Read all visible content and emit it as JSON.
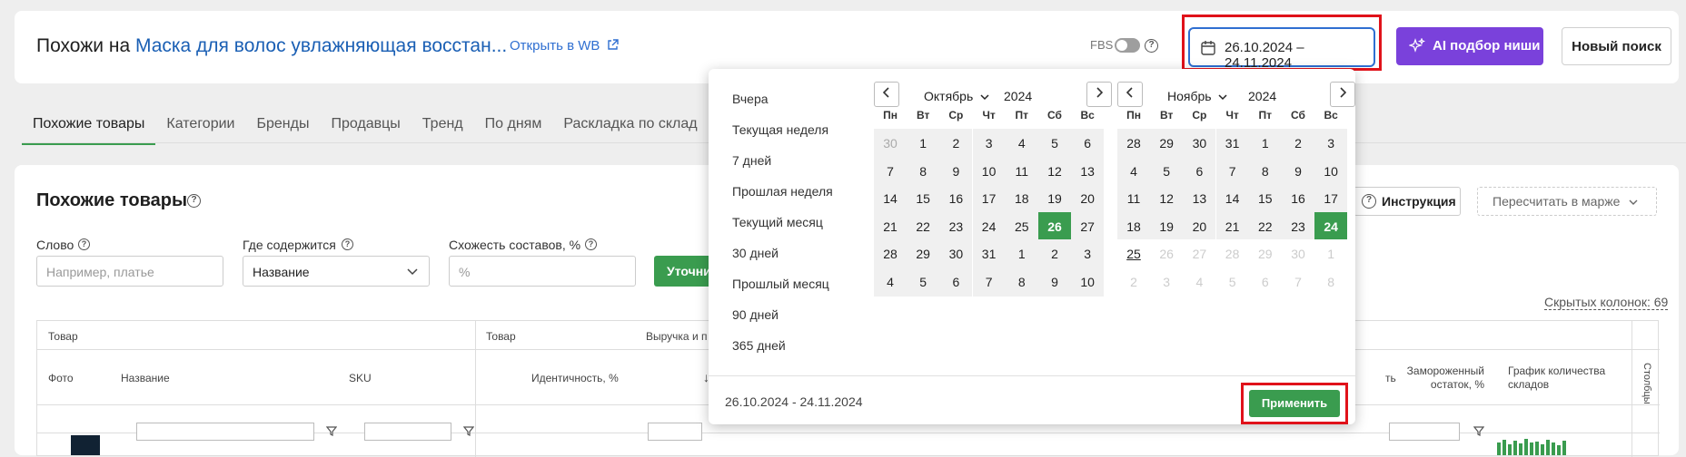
{
  "header": {
    "title_prefix": "Похожи на",
    "product_link": "Маска для волос увлажняющая восстан...",
    "open_wb": "Открыть в WB",
    "fbs_label": "FBS",
    "date_range": "26.10.2024 – 24.11.2024",
    "ai_button": "AI подбор ниши",
    "new_search": "Новый поиск"
  },
  "tabs": [
    "Похожие товары",
    "Категории",
    "Бренды",
    "Продавцы",
    "Тренд",
    "По дням",
    "Раскладка по склад"
  ],
  "main": {
    "section_title": "Похожие товары",
    "instruction": "Инструкция",
    "recalc": "Пересчитать в марже",
    "hidden_cols": "Скрытых колонок: 69",
    "filters": {
      "word_label": "Слово",
      "word_placeholder": "Например, платье",
      "where_label": "Где содержится",
      "where_value": "Название",
      "similarity_label": "Схожесть составов, %",
      "similarity_placeholder": "%",
      "refine_button": "Уточни"
    },
    "table": {
      "group1": "Товар",
      "group2": "Товар",
      "group3": "Выручка и п",
      "col_photo": "Фото",
      "col_name": "Название",
      "col_sku": "SKU",
      "col_ident": "Идентичность, %",
      "col_t": "ть",
      "col_frozen": "Замороженный остаток, %",
      "col_graph": "График количества складов",
      "col_columns": "Столбцы",
      "sort_arrow": "↓"
    }
  },
  "datepicker": {
    "presets": [
      "Вчера",
      "Текущая неделя",
      "7 дней",
      "Прошлая неделя",
      "Текущий месяц",
      "30 дней",
      "Прошлый месяц",
      "90 дней",
      "365 дней"
    ],
    "weekdays": [
      "Пн",
      "Вт",
      "Ср",
      "Чт",
      "Пт",
      "Сб",
      "Вс"
    ],
    "left": {
      "month": "Октябрь",
      "year": "2024",
      "days": [
        [
          "30",
          "1",
          "2",
          "3",
          "4",
          "5",
          "6"
        ],
        [
          "7",
          "8",
          "9",
          "10",
          "11",
          "12",
          "13"
        ],
        [
          "14",
          "15",
          "16",
          "17",
          "18",
          "19",
          "20"
        ],
        [
          "21",
          "22",
          "23",
          "24",
          "25",
          "26",
          "27"
        ],
        [
          "28",
          "29",
          "30",
          "31",
          "1",
          "2",
          "3"
        ],
        [
          "4",
          "5",
          "6",
          "7",
          "8",
          "9",
          "10"
        ]
      ]
    },
    "right": {
      "month": "Ноябрь",
      "year": "2024",
      "days": [
        [
          "28",
          "29",
          "30",
          "31",
          "1",
          "2",
          "3"
        ],
        [
          "4",
          "5",
          "6",
          "7",
          "8",
          "9",
          "10"
        ],
        [
          "11",
          "12",
          "13",
          "14",
          "15",
          "16",
          "17"
        ],
        [
          "18",
          "19",
          "20",
          "21",
          "22",
          "23",
          "24"
        ],
        [
          "25",
          "26",
          "27",
          "28",
          "29",
          "30",
          "1"
        ],
        [
          "2",
          "3",
          "4",
          "5",
          "6",
          "7",
          "8"
        ]
      ]
    },
    "footer_date": "26.10.2024 - 24.11.2024",
    "apply": "Применить"
  },
  "colors": {
    "accent_green": "#3a9c4f",
    "link_blue": "#1a5fb4",
    "ai_purple": "#7a41db",
    "highlight_red": "#e0121a"
  }
}
